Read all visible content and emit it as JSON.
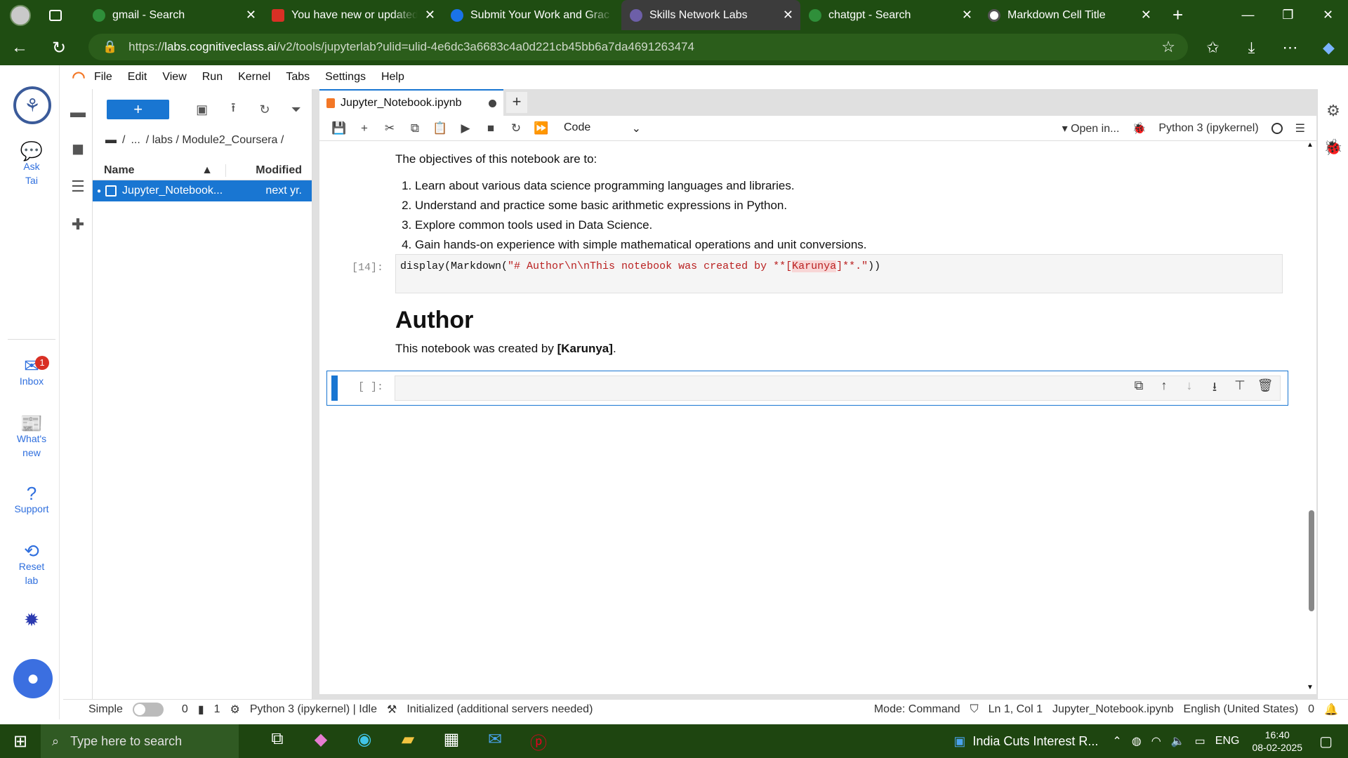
{
  "browser": {
    "tabs": [
      {
        "label": "gmail - Search",
        "fav_color": "#2f8f3a"
      },
      {
        "label": "You have new or updated g",
        "fav_color": "#d93025"
      },
      {
        "label": "Submit Your Work and Grac",
        "fav_color": "#1a73e8"
      },
      {
        "label": "Skills Network Labs",
        "fav_color": "#6d5fa8",
        "active": true
      },
      {
        "label": "chatgpt - Search",
        "fav_color": "#2f8f3a"
      },
      {
        "label": "Markdown Cell Title",
        "fav_color": "#ffffff"
      }
    ],
    "url_prefix": "https://",
    "url_host": "labs.cognitiveclass.ai",
    "url_path": "/v2/tools/jupyterlab?ulid=ulid-4e6dc3a6683c4a0d221cb45bb6a7da4691263474"
  },
  "rail": {
    "ask": "Ask Tai",
    "inbox": "Inbox",
    "inbox_badge": "1",
    "whats_new": "What's new",
    "support": "Support",
    "reset": "Reset lab"
  },
  "menu": [
    "File",
    "Edit",
    "View",
    "Run",
    "Kernel",
    "Tabs",
    "Settings",
    "Help"
  ],
  "filebrowser": {
    "new_label": "+",
    "crumb_root": "/",
    "crumb_more": "...",
    "crumb_path": "/ labs / Module2_Coursera /",
    "col_name": "Name",
    "col_modified": "Modified",
    "file_name": "Jupyter_Notebook...",
    "file_modified": "next yr."
  },
  "notebook": {
    "tab_title": "Jupyter_Notebook.ipynb",
    "cell_type": "Code",
    "open_in": "Open in...",
    "kernel": "Python 3 (ipykernel)",
    "objectives_intro": "The objectives of this notebook are to:",
    "objectives": [
      "Learn about various data science programming languages and libraries.",
      "Understand and practice some basic arithmetic expressions in Python.",
      "Explore common tools used in Data Science.",
      "Gain hands-on experience with simple mathematical operations and unit conversions."
    ],
    "code_prompt": "[14]:",
    "code_prefix": "display(Markdown(",
    "code_str1": "\"# Author\\n\\nThis notebook was created by **[",
    "code_hl": "Karunya",
    "code_str2": "]**.\"",
    "code_suffix": "))",
    "heading": "Author",
    "author_text": "This notebook was created by ",
    "author_name": "[Karunya]",
    "author_end": ".",
    "empty_prompt": "[ ]:"
  },
  "status": {
    "mode_label": "Simple",
    "terminals": "0",
    "kernels": "1",
    "kernel_state": "Python 3 (ipykernel) | Idle",
    "init": "Initialized (additional servers needed)",
    "mode": "Mode: Command",
    "position": "Ln 1, Col 1",
    "file": "Jupyter_Notebook.ipynb",
    "lang": "English (United States)",
    "notifications": "0"
  },
  "taskbar": {
    "search_placeholder": "Type here to search",
    "news": "India Cuts Interest R...",
    "lang": "ENG",
    "time": "16:40",
    "date": "08-02-2025"
  }
}
